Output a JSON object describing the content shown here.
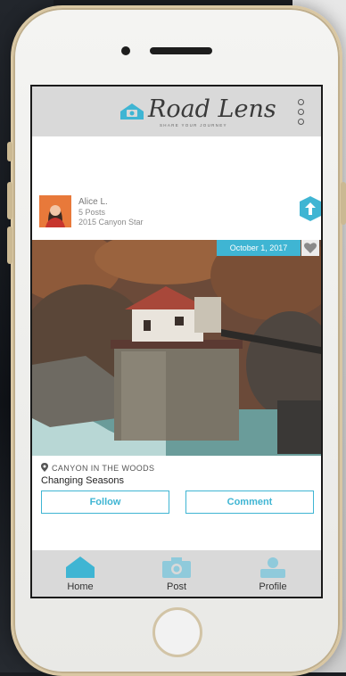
{
  "app": {
    "logo_text": "Road Lens",
    "tagline": "SHARE YOUR JOURNEY",
    "accent_color": "#3fb5d3"
  },
  "post": {
    "user": {
      "name": "Alice L.",
      "posts": "5 Posts",
      "rank": "2015 Canyon Star"
    },
    "date": "October 1, 2017",
    "location": "CANYON IN THE WOODS",
    "caption": "Changing Seasons",
    "actions": {
      "follow_label": "Follow",
      "comment_label": "Comment"
    }
  },
  "nav": {
    "items": [
      {
        "label": "Home",
        "icon": "house-icon"
      },
      {
        "label": "Post",
        "icon": "camera-icon"
      },
      {
        "label": "Profile",
        "icon": "profile-icon"
      }
    ]
  },
  "icons": {
    "share": "share-arrow-icon",
    "favorite": "heart-icon",
    "menu": "kebab-menu-icon",
    "location": "location-pin-icon"
  }
}
